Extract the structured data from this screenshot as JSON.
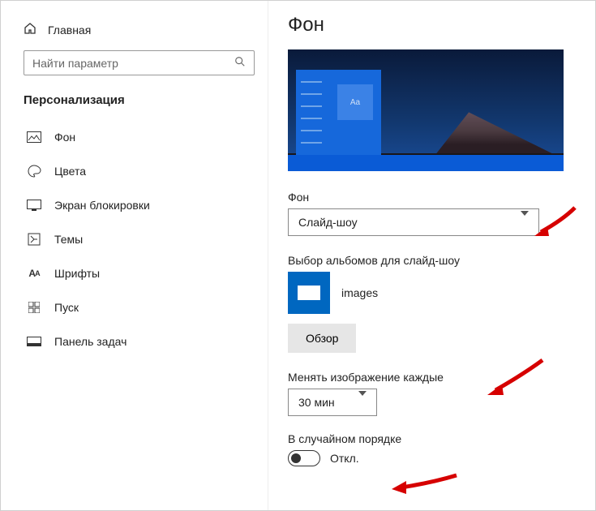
{
  "sidebar": {
    "home": "Главная",
    "search_placeholder": "Найти параметр",
    "category": "Персонализация",
    "items": [
      {
        "label": "Фон"
      },
      {
        "label": "Цвета"
      },
      {
        "label": "Экран блокировки"
      },
      {
        "label": "Темы"
      },
      {
        "label": "Шрифты"
      },
      {
        "label": "Пуск"
      },
      {
        "label": "Панель задач"
      }
    ]
  },
  "content": {
    "title": "Фон",
    "preview_tile": "Aa",
    "background_label": "Фон",
    "background_value": "Слайд-шоу",
    "album_label": "Выбор альбомов для слайд-шоу",
    "album_name": "images",
    "browse": "Обзор",
    "change_label": "Менять изображение каждые",
    "change_value": "30 мин",
    "random_label": "В случайном порядке",
    "random_state": "Откл."
  }
}
